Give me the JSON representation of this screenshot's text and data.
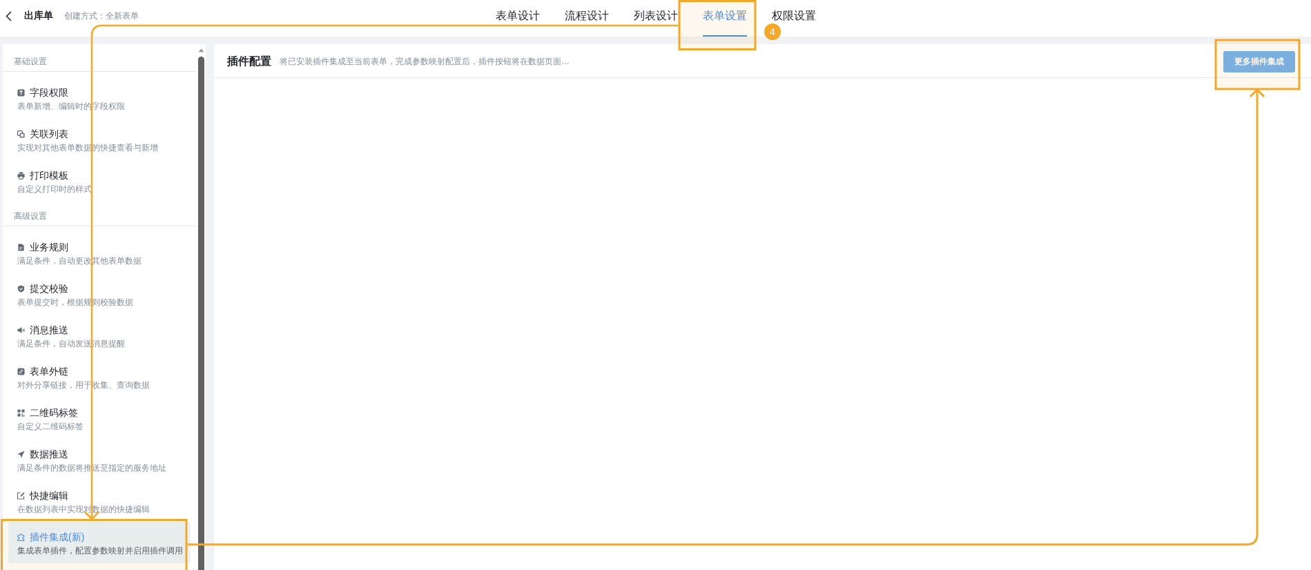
{
  "header": {
    "title": "出库单",
    "subtitle": "创建方式：全新表单"
  },
  "tabs": [
    {
      "label": "表单设计",
      "selected": false
    },
    {
      "label": "流程设计",
      "selected": false
    },
    {
      "label": "列表设计",
      "selected": false
    },
    {
      "label": "表单设置",
      "selected": true
    },
    {
      "label": "权限设置",
      "selected": false
    }
  ],
  "sidebar": {
    "sections": [
      {
        "heading": "基础设置",
        "items": [
          {
            "kind": "permission",
            "title": "字段权限",
            "description": "表单新增、编辑时的字段权限",
            "selected": false
          },
          {
            "kind": "related",
            "title": "关联列表",
            "description": "实现对其他表单数据的快捷查看与新增",
            "selected": false
          },
          {
            "kind": "print",
            "title": "打印模板",
            "description": "自定义打印时的样式",
            "selected": false
          }
        ]
      },
      {
        "heading": "高级设置",
        "items": [
          {
            "kind": "rule",
            "title": "业务规则",
            "description": "满足条件，自动更改其他表单数据",
            "selected": false
          },
          {
            "kind": "validation",
            "title": "提交校验",
            "description": "表单提交时，根据规则校验数据",
            "selected": false
          },
          {
            "kind": "message",
            "title": "消息推送",
            "description": "满足条件，自动发送消息提醒",
            "selected": false
          },
          {
            "kind": "share",
            "title": "表单外链",
            "description": "对外分享链接，用于收集、查询数据",
            "selected": false
          },
          {
            "kind": "qrcode",
            "title": "二维码标签",
            "description": "自定义二维码标签",
            "selected": false
          },
          {
            "kind": "push",
            "title": "数据推送",
            "description": "满足条件的数据将推送至指定的服务地址",
            "selected": false
          },
          {
            "kind": "edit",
            "title": "快捷编辑",
            "description": "在数据列表中实现对数据的快捷编辑",
            "selected": false
          },
          {
            "kind": "plugin",
            "title": "插件集成(新)",
            "description": "集成表单插件，配置参数映射并启用插件调用",
            "selected": true
          }
        ]
      }
    ]
  },
  "panel": {
    "title": "插件配置",
    "description": "将已安装插件集成至当前表单，完成参数映射配置后，插件按钮将在数据页面…",
    "button": "更多插件集成"
  },
  "annotation": {
    "step_badge": "4"
  }
}
